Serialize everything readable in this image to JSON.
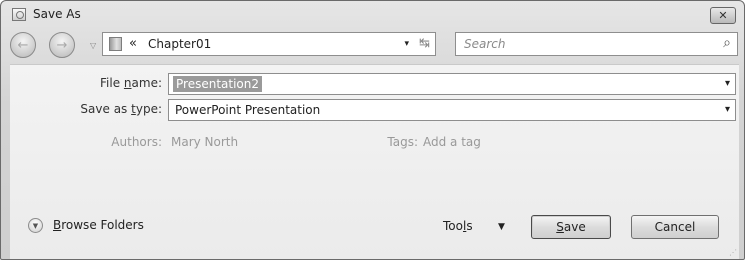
{
  "window": {
    "title": "Save As",
    "close_glyph": "✕"
  },
  "nav": {
    "back_glyph": "←",
    "forward_glyph": "→",
    "dropdown_glyph": "▽",
    "path_prefix": "«",
    "path": "Chapter01",
    "path_caret": "▾",
    "refresh_glyph": "↹",
    "search_placeholder": "Search",
    "search_glyph": "⌕"
  },
  "form": {
    "file_name": {
      "label_pre": "File ",
      "label_u": "n",
      "label_post": "ame:",
      "value": "Presentation2",
      "caret": "▾"
    },
    "save_type": {
      "label_pre": "Save as ",
      "label_u": "t",
      "label_post": "ype:",
      "value": "PowerPoint Presentation",
      "caret": "▾"
    },
    "authors": {
      "label": "Authors:",
      "value": "Mary North"
    },
    "tags": {
      "label": "Tags:",
      "value": "Add a tag"
    }
  },
  "footer": {
    "browse_glyph": "▼",
    "browse_u": "B",
    "browse_rest": "rowse Folders",
    "tools_pre": "Too",
    "tools_u": "l",
    "tools_post": "s",
    "tools_caret": "▼",
    "save_u": "S",
    "save_rest": "ave",
    "cancel": "Cancel",
    "grip": "⋰"
  }
}
